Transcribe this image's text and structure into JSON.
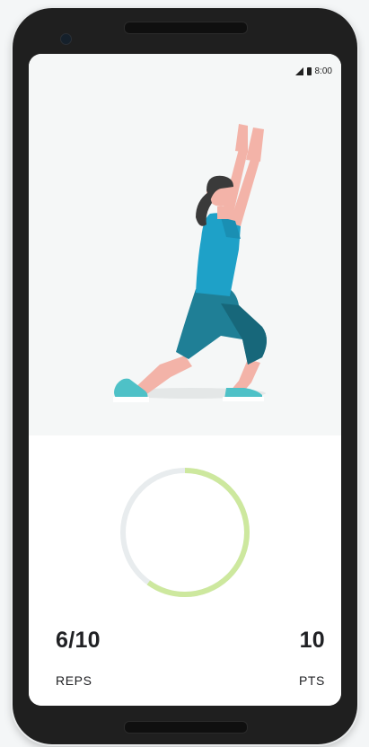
{
  "status_bar": {
    "time": "8:00"
  },
  "progress": {
    "fraction": 0.6,
    "track_color": "#e8ecee",
    "fill_color": "#cde89e"
  },
  "stats": {
    "reps": {
      "value": "6/10",
      "label": "REPS"
    },
    "points": {
      "value": "10",
      "label": "PTS"
    }
  },
  "icons": {
    "signal": "signal-icon",
    "battery": "battery-icon"
  }
}
